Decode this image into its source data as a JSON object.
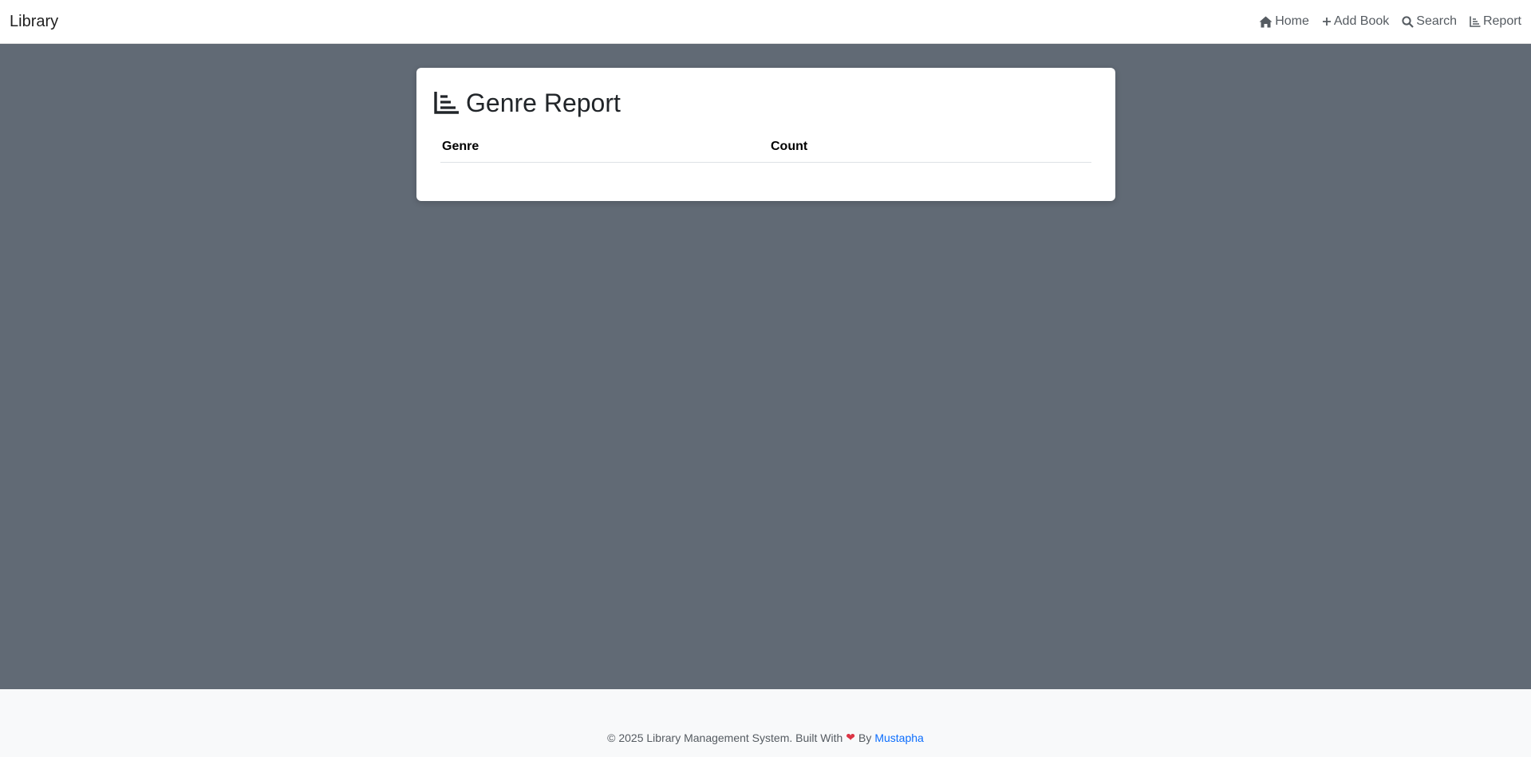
{
  "navbar": {
    "brand": "Library",
    "links": [
      {
        "label": "Home",
        "icon": "home-icon"
      },
      {
        "label": "Add Book",
        "icon": "plus-icon"
      },
      {
        "label": "Search",
        "icon": "search-icon"
      },
      {
        "label": "Report",
        "icon": "chart-icon"
      }
    ]
  },
  "report": {
    "title": "Genre Report",
    "columns": [
      "Genre",
      "Count"
    ],
    "rows": []
  },
  "footer": {
    "text": "© 2025 Library Management System. Built With",
    "heart": "❤",
    "by": "By",
    "author": "Mustapha"
  },
  "colors": {
    "background": "#616a75",
    "link": "#0d6efd",
    "heart": "#dc3545"
  }
}
